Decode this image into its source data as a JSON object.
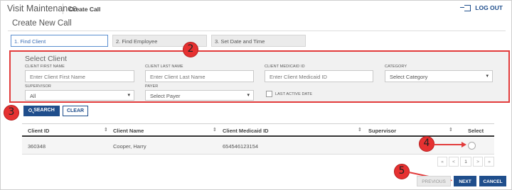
{
  "header": {
    "app_title": "Visit Maintenance",
    "breadcrumb": "Create Call",
    "logout_label": "LOG OUT"
  },
  "page_title": "Create New Call",
  "steps": [
    {
      "label": "1. Find Client",
      "active": true
    },
    {
      "label": "2. Find Employee",
      "active": false
    },
    {
      "label": "3. Set Date and Time",
      "active": false
    }
  ],
  "select_client": {
    "title": "Select Client",
    "fields": {
      "first_name": {
        "label": "CLIENT FIRST NAME",
        "placeholder": "Enter Client First Name"
      },
      "last_name": {
        "label": "CLIENT LAST NAME",
        "placeholder": "Enter Client Last Name"
      },
      "medicaid_id": {
        "label": "CLIENT MEDICAID ID",
        "placeholder": "Enter Client Medicaid ID"
      },
      "category": {
        "label": "CATEGORY",
        "value": "Select Category"
      },
      "supervisor": {
        "label": "SUPERVISOR",
        "value": "All"
      },
      "payer": {
        "label": "PAYER",
        "value": "Select Payer"
      },
      "last_active_date": {
        "label": "LAST ACTIVE DATE"
      }
    }
  },
  "actions": {
    "search_label": "SEARCH",
    "clear_label": "CLEAR"
  },
  "table": {
    "columns": [
      "Client ID",
      "Client Name",
      "Client Medicaid ID",
      "Supervisor",
      "Select"
    ],
    "rows": [
      {
        "client_id": "360348",
        "client_name": "Cooper, Harry",
        "medicaid_id": "654546123154",
        "supervisor": ""
      }
    ]
  },
  "pagination": {
    "first": "«",
    "prev": "<",
    "current": "1",
    "next": ">",
    "last": "»"
  },
  "footer": {
    "previous_label": "PREVIOUS",
    "next_label": "NEXT",
    "cancel_label": "CANCEL"
  },
  "callouts": [
    "2",
    "3",
    "4",
    "5"
  ],
  "colors": {
    "accent": "#1f4e8c",
    "callout": "#e63131"
  }
}
